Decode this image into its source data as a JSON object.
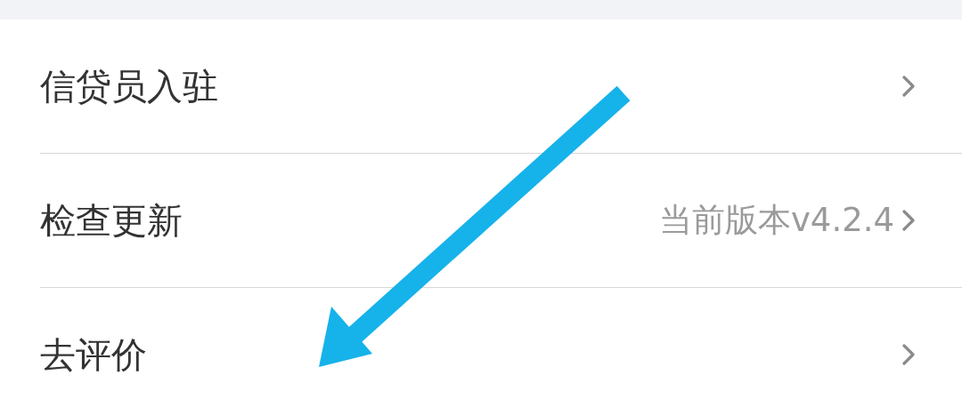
{
  "settings_items": [
    {
      "label": "信贷员入驻"
    },
    {
      "label": "检查更新",
      "value": "当前版本v4.2.4"
    },
    {
      "label": "去评价"
    }
  ]
}
